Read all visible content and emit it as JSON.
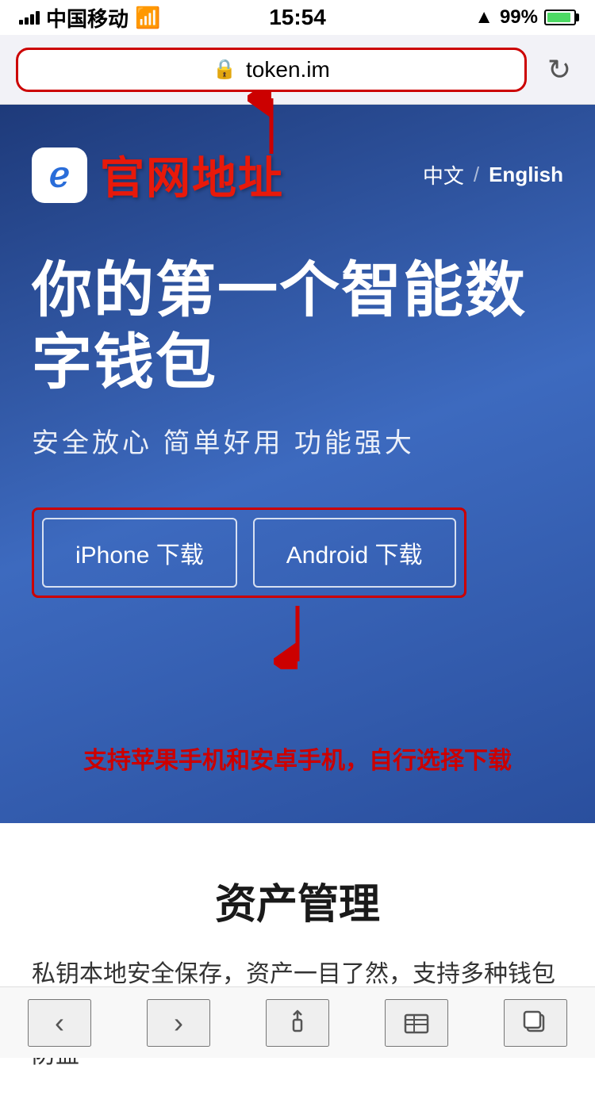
{
  "status_bar": {
    "carrier": "中国移动",
    "time": "15:54",
    "battery_percent": "99%",
    "location_icon": "▲"
  },
  "browser": {
    "url": "token.im",
    "lock_icon": "🔒",
    "refresh_icon": "↻"
  },
  "hero": {
    "logo_char": "ℯ",
    "site_label": "官网地址",
    "lang_cn": "中文",
    "lang_divider": "/",
    "lang_en": "English",
    "headline": "你的第一个智能数字钱包",
    "subtitle": "安全放心  简单好用  功能强大",
    "iphone_btn": "iPhone 下载",
    "android_btn": "Android 下载",
    "annotation": "支持苹果手机和安卓手机，自行选择下载"
  },
  "info": {
    "title": "资产管理",
    "body": "私钥本地安全保存，资产一目了然，支持多种钱包类型，轻松导入导出，助记词备份防丢，多重签名防盗"
  },
  "bottom_nav": {
    "back": "‹",
    "forward": "›",
    "share": "⬆",
    "bookmarks": "□□",
    "tabs": "□"
  }
}
